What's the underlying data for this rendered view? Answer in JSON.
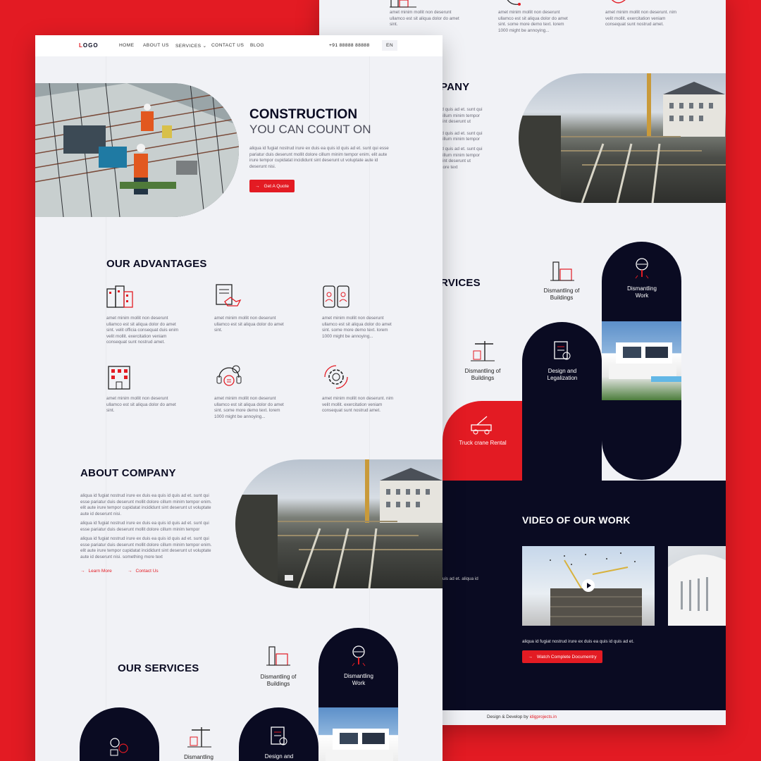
{
  "nav": {
    "logo": "LOGO",
    "items": [
      "HOME",
      "ABOUT US",
      "SERVICES",
      "CONTACT US",
      "BLOG"
    ],
    "phone": "+91 88888 88888",
    "lang": "EN"
  },
  "hero": {
    "title_line1": "CONSTRUCTION",
    "title_line2": "YOU CAN COUNT ON",
    "body": "aliqua id fugiat nostrud irure ex duis ea quis id quis ad et. sunt qui esse pariatur duis deserunt mollit dolore cillum minim tempor enim. elit aute irure tempor cupidatat incididunt sint deserunt ut voluptate aute id deserunt nisi.",
    "cta": "Get A Quote"
  },
  "advantages": {
    "title": "OUR ADVANTAGES",
    "items": [
      {
        "icon": "buildings-icon",
        "text": "amet minim mollit non deserunt ullamco est sit aliqua dolor do amet sint. velit officia consequat duis enim velit mollit. exercitation veniam consequat sunt nostrud amet."
      },
      {
        "icon": "handshake-document-icon",
        "text": "amet minim mollit non deserunt ullamco est sit aliqua dolor do amet sint."
      },
      {
        "icon": "phones-users-icon",
        "text": "amet minim mollit non deserunt ullamco est sit aliqua dolor do amet sint. some more demo text. lorem 1000 might be annoying..."
      },
      {
        "icon": "office-building-icon",
        "text": "amet minim mollit non deserunt ullamco est sit aliqua dolor do amet sint."
      },
      {
        "icon": "support-headset-icon",
        "text": "amet minim mollit non deserunt ullamco est sit aliqua dolor do amet sint. some more demo text. lorem 1000 might be annoying..."
      },
      {
        "icon": "gear-icon",
        "text": "amet minim mollit non deserunt. nim velit mollit. exercitation veniam consequat sunt nostrud amet."
      }
    ]
  },
  "about": {
    "title": "ABOUT COMPANY",
    "paragraphs": [
      "aliqua id fugiat nostrud irure ex duis ea quis id quis ad et. sunt qui esse pariatur duis deserunt mollit dolore cillum minim tempor enim. elit aute irure tempor cupidatat incididunt sint deserunt ut voluptate aute id deserunt nisi.",
      "aliqua id fugiat nostrud irure ex duis ea quis id quis ad et. sunt qui esse pariatur duis deserunt mollit dolore cillum minim tempor",
      "aliqua id fugiat nostrud irure ex duis ea quis id quis ad et. sunt qui esse pariatur duis deserunt mollit dolore cillum minim tempor enim. elit aute irure tempor cupidatat incididunt sint deserunt ut voluptate aute id deserunt nisi. something more text"
    ],
    "learn_more": "Learn More",
    "contact_us": "Contact Us"
  },
  "services": {
    "title": "OUR SERVICES",
    "dismantling_buildings": "Dismantling of Buildings",
    "dismantling_work": "Dismantling Work",
    "design_legalization": "Design and Legalization",
    "truck_crane": "Truck crane Rental",
    "front_design": "Design and",
    "front_dismantling": "Dismantling"
  },
  "back": {
    "top_texts": [
      "amet minim mollit non deserunt ullamco est sit aliqua dolor do amet sint.",
      "amet minim mollit non deserunt ullamco est sit aliqua dolor do amet sint. some more demo text. lorem 1000 might be annoying...",
      "amet minim mollit non deserunt. nim velit mollit. exercitation veniam consequat sunt nostrud amet."
    ],
    "about_partial": "PANY",
    "about_lines": [
      "id quis ad et. sunt qui",
      "cillum minim tempor",
      "sint deserunt ut",
      "id quis ad et. sunt qui",
      "cillum minim tempor",
      "id quis ad et. sunt qui",
      "cillum minim tempor",
      "sint deserunt ut",
      "nore text"
    ],
    "services_partial": "RVICES",
    "video_title": "VIDEO OF OUR WORK",
    "video_side_text": "uis ad et. aliqua id",
    "video_caption": "aliqua id fugiat nostrud irure ex duis ea quis id quis ad et.",
    "video_cta": "Watch Complete Documentry",
    "footer_prefix": "Design & Develop by",
    "footer_link": "idigprojects.in"
  },
  "colors": {
    "accent": "#e31b23",
    "navy": "#0a0b22",
    "page": "#f1f2f6"
  }
}
